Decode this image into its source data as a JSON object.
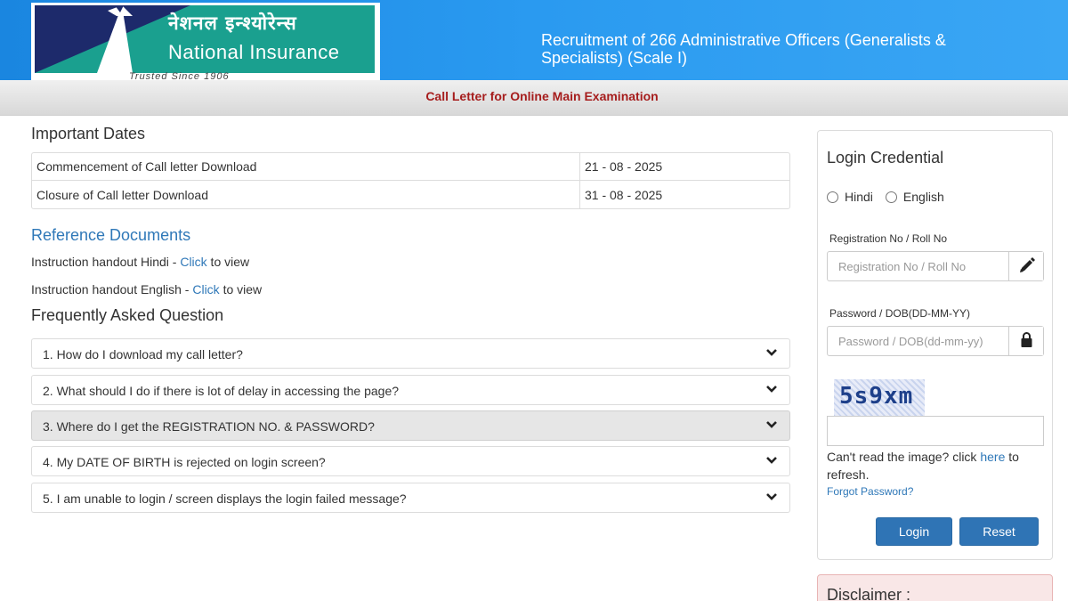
{
  "header": {
    "logo_hindi": "नेशनल इन्श्योरेन्स",
    "logo_english": "National Insurance",
    "logo_tagline": "Trusted Since 1906",
    "title": "Recruitment of 266 Administrative Officers (Generalists & Specialists) (Scale I)"
  },
  "subheader": {
    "title": "Call Letter for Online Main Examination"
  },
  "important_dates": {
    "title": "Important Dates",
    "rows": [
      {
        "label": "Commencement of Call letter Download",
        "value": "21 - 08 - 2025"
      },
      {
        "label": "Closure of Call letter Download",
        "value": "31 - 08 - 2025"
      }
    ]
  },
  "reference": {
    "title": "Reference Documents",
    "items": [
      {
        "prefix": "Instruction handout Hindi - ",
        "link": "Click",
        "suffix": " to view"
      },
      {
        "prefix": "Instruction handout English - ",
        "link": "Click",
        "suffix": " to view"
      }
    ]
  },
  "faq": {
    "title": "Frequently Asked Question",
    "items": [
      "1. How do I download my call letter?",
      "2. What should I do if there is lot of delay in accessing the page?",
      "3. Where do I get the REGISTRATION NO. & PASSWORD?",
      "4. My DATE OF BIRTH is rejected on login screen?",
      "5. I am unable to login / screen displays the login failed message?"
    ]
  },
  "login": {
    "title": "Login Credential",
    "lang_options": [
      "Hindi",
      "English"
    ],
    "reg_label": "Registration No / Roll No",
    "reg_placeholder": "Registration No / Roll No",
    "pwd_label": "Password / DOB(DD-MM-YY)",
    "pwd_placeholder": "Password / DOB(dd-mm-yy)",
    "captcha_text": "5s9xm",
    "refresh_prefix": "Can't read the image? click ",
    "refresh_link": "here",
    "refresh_suffix": " to refresh.",
    "forgot": "Forgot Password?",
    "login_button": "Login",
    "reset_button": "Reset"
  },
  "disclaimer": {
    "title": "Disclaimer :"
  },
  "colors": {
    "header_blue": "#1a86e0",
    "logo_teal": "#1aa08f",
    "subheader_red": "#a61d1d",
    "link_blue": "#2f78b8",
    "button_blue": "#2f74b5"
  }
}
